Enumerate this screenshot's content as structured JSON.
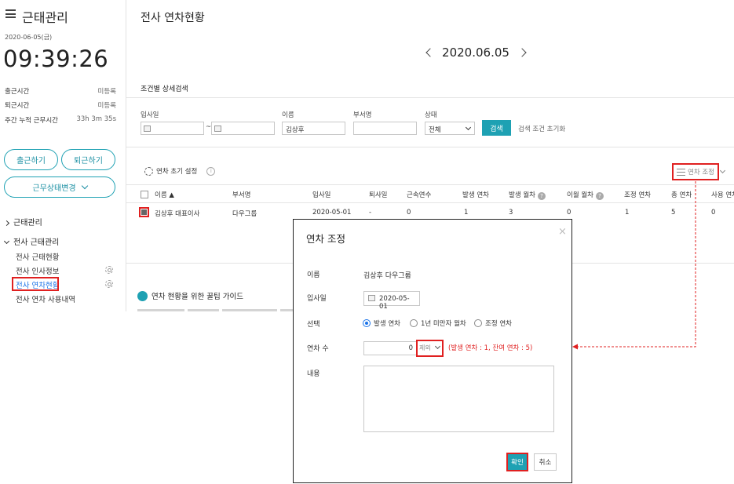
{
  "sidebar": {
    "app_title": "근태관리",
    "date": "2020-06-05(금)",
    "clock": "09:39:26",
    "stats": [
      {
        "label": "출근시간",
        "value": "미등록"
      },
      {
        "label": "퇴근시간",
        "value": "미등록"
      },
      {
        "label": "주간 누적 근무시간",
        "value": "33h 3m 35s"
      }
    ],
    "clock_in_button": "출근하기",
    "clock_out_button": "퇴근하기",
    "status_change_button": "근무상태변경",
    "groups": [
      {
        "label": "근태관리"
      },
      {
        "label": "전사 근태관리"
      }
    ],
    "items": [
      {
        "label": "전사 근태현황"
      },
      {
        "label": "전사 인사정보"
      },
      {
        "label": "전사 연차현황"
      },
      {
        "label": "전사 연차 사용내역"
      }
    ]
  },
  "main": {
    "page_title": "전사 연차현황",
    "current_date": "2020.06.05",
    "search_section_label": "조건별 상세검색",
    "filters": {
      "join_date_label": "입사일",
      "date_separator": "~",
      "name_label": "이름",
      "name_value": "김상후",
      "dept_label": "부서명",
      "dept_value": "",
      "status_label": "상태",
      "status_value": "전체",
      "search_button": "검색",
      "reset_link": "검색 조건 초기화"
    },
    "toolbar": {
      "initial_setting": "연차 초기 설정",
      "adjust_button": "연차 조정"
    },
    "table": {
      "headers": [
        "이름 ▲",
        "부서명",
        "입사일",
        "퇴사일",
        "근속연수",
        "발생 연차",
        "발생 월차",
        "이월 월차",
        "조정 연차",
        "총 연차",
        "사용 연차"
      ],
      "row": [
        "김상후 대표이사",
        "다우그룹",
        "2020-05-01",
        "-",
        "0",
        "1",
        "3",
        "0",
        "1",
        "5",
        "0"
      ]
    },
    "guide_title": "연차 현황을 위한 꿀팁 가이드"
  },
  "dialog": {
    "title": "연차 조정",
    "close": "×",
    "name_label": "이름",
    "name_value": "김상후 다우그룹",
    "join_label": "입사일",
    "join_value": "2020-05-01",
    "choice_label": "선택",
    "options": [
      "발생 연차",
      "1년 미만자 월차",
      "조정 연차"
    ],
    "selected_option": "발생 연차",
    "count_label": "연차 수",
    "count_value": "0",
    "exclude_select": "제외",
    "count_note": "(발생 연차 : 1, 잔여 연차 : 5)",
    "content_label": "내용",
    "confirm_button": "확인",
    "cancel_button": "취소"
  },
  "colors": {
    "accent": "#1ea1b3",
    "highlight": "#e02020",
    "radio_selected": "#1a73e8"
  }
}
